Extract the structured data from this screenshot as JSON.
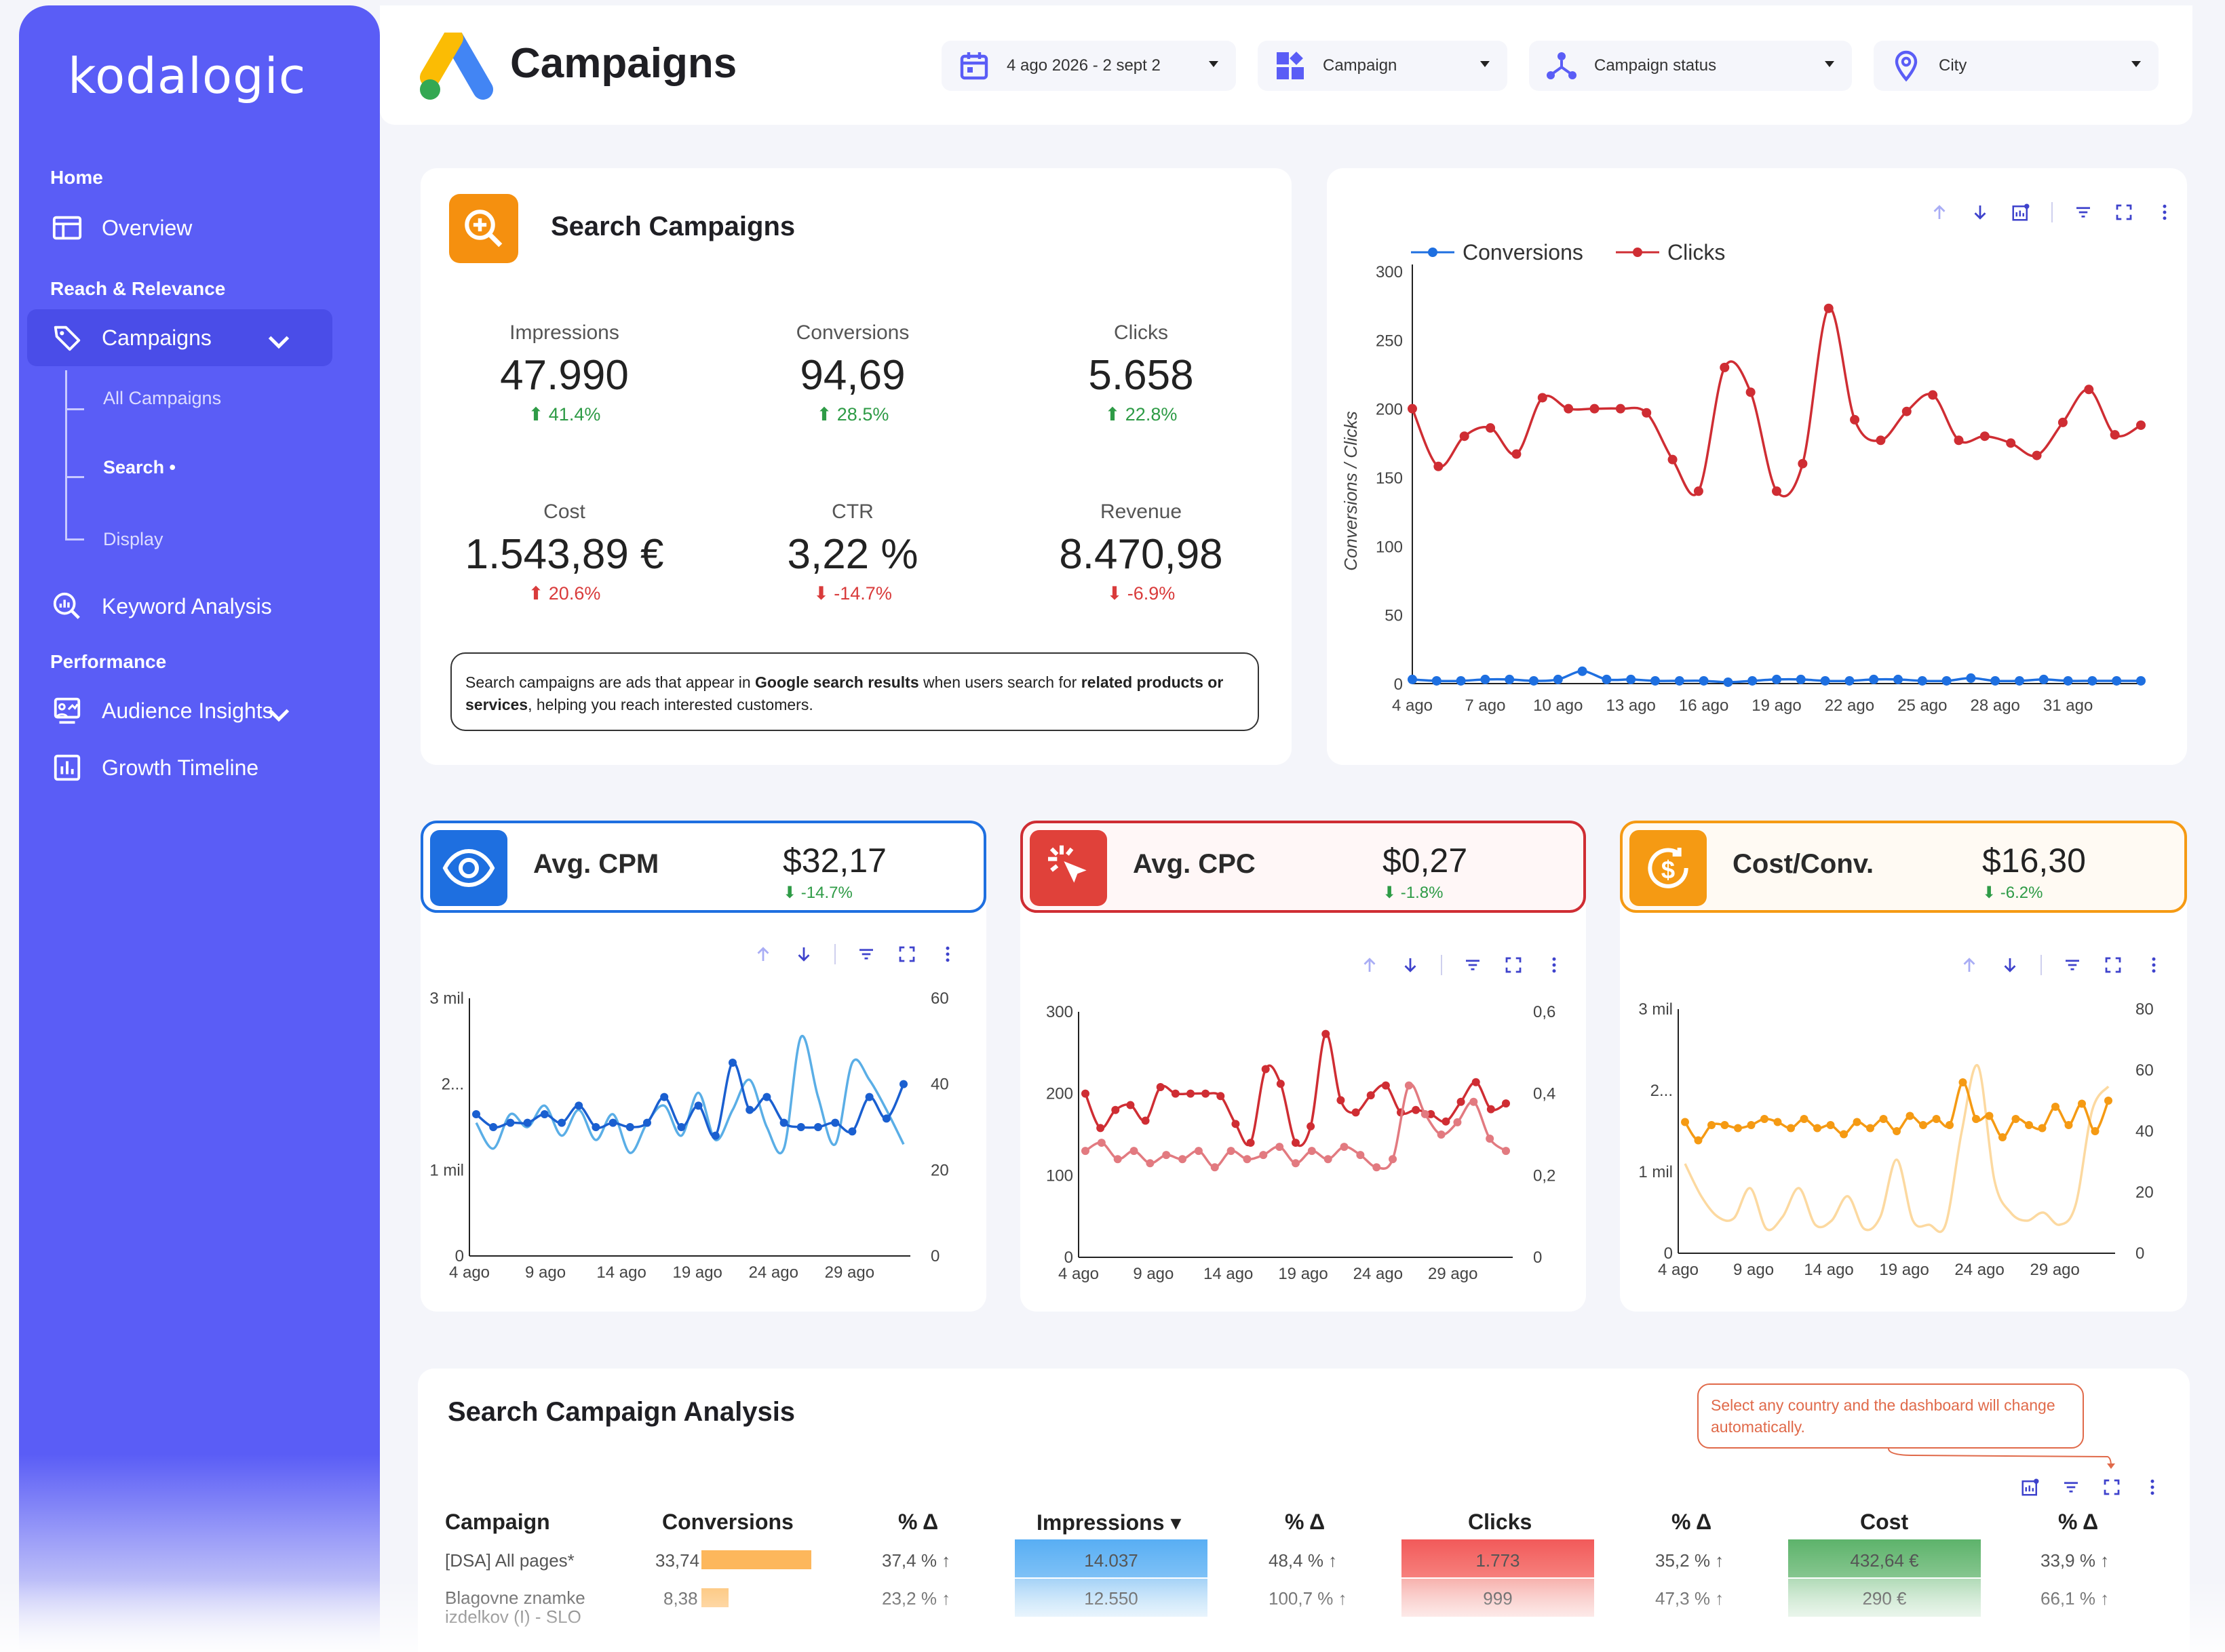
{
  "brand": {
    "logo_text": "kodalogic"
  },
  "colors": {
    "sidebar": "#5a5df6",
    "accent_red": "#cf2d33",
    "accent_blue": "#1e6fe0",
    "accent_orange": "#f59a13",
    "positive": "#2e9b46",
    "negative": "#d93b3b"
  },
  "sidebar": {
    "sections": [
      {
        "title": "Home",
        "items": [
          {
            "label": "Overview",
            "icon": "dashboard-icon"
          }
        ]
      },
      {
        "title": "Reach & Relevance",
        "items": [
          {
            "label": "Campaigns",
            "icon": "tag-icon",
            "expanded": true,
            "sub": [
              "All Campaigns",
              "Search •",
              "Display"
            ]
          },
          {
            "label": "Keyword Analysis",
            "icon": "magnify-chart-icon"
          }
        ]
      },
      {
        "title": "Performance",
        "items": [
          {
            "label": "Audience Insights",
            "icon": "audience-icon"
          },
          {
            "label": "Growth Timeline",
            "icon": "bar-chart-icon"
          }
        ]
      }
    ]
  },
  "header": {
    "title": "Campaigns",
    "filters": {
      "date": "4 ago 2026 - 2 sept 2",
      "campaign": "Campaign",
      "status": "Campaign status",
      "city": "City"
    }
  },
  "search_card": {
    "title": "Search Campaigns",
    "kpis": [
      {
        "label": "Impressions",
        "value": "47.990",
        "delta": "41.4%",
        "dir": "up"
      },
      {
        "label": "Conversions",
        "value": "94,69",
        "delta": "28.5%",
        "dir": "up"
      },
      {
        "label": "Clicks",
        "value": "5.658",
        "delta": "22.8%",
        "dir": "up"
      },
      {
        "label": "Cost",
        "value": "1.543,89 €",
        "delta": "20.6%",
        "dir": "up_bad"
      },
      {
        "label": "CTR",
        "value": "3,22 %",
        "delta": "-14.7%",
        "dir": "down"
      },
      {
        "label": "Revenue",
        "value": "8.470,98",
        "delta": "-6.9%",
        "dir": "down"
      }
    ],
    "note_parts": [
      "Search campaigns are ads that appear in ",
      "Google search results",
      " when users search for ",
      "related products or services",
      ", helping you reach interested customers."
    ]
  },
  "metrics": [
    {
      "name": "Avg. CPM",
      "value": "$32,17",
      "delta": "-14.7%",
      "icon": "eye-icon",
      "color": "#1e6fe0"
    },
    {
      "name": "Avg. CPC",
      "value": "$0,27",
      "delta": "-1.8%",
      "icon": "click-icon",
      "color": "#cf2d33"
    },
    {
      "name": "Cost/Conv.",
      "value": "$16,30",
      "delta": "-6.2%",
      "icon": "dollar-icon",
      "color": "#f59a13"
    }
  ],
  "chart_data": [
    {
      "type": "line",
      "title": "",
      "xlabel": "",
      "ylabel": "Conversions / Clicks",
      "ylim": [
        0,
        300
      ],
      "yticks": [
        "0",
        "50",
        "100",
        "150",
        "200",
        "250",
        "300"
      ],
      "x_tick_labels": [
        "4 ago",
        "7 ago",
        "10 ago",
        "13 ago",
        "16 ago",
        "19 ago",
        "22 ago",
        "25 ago",
        "28 ago",
        "31 ago"
      ],
      "legend": "top-left",
      "series": [
        {
          "name": "Conversions",
          "color": "#1e6fe0",
          "values": [
            3,
            2,
            2,
            3,
            3,
            2,
            3,
            9,
            3,
            3,
            2,
            2,
            2,
            1,
            2,
            3,
            3,
            2,
            2,
            3,
            3,
            2,
            2,
            4,
            2,
            2,
            3,
            2,
            2,
            2,
            2
          ]
        },
        {
          "name": "Clicks",
          "color": "#cf2d33",
          "values": [
            200,
            158,
            180,
            186,
            167,
            208,
            200,
            200,
            200,
            197,
            163,
            140,
            230,
            212,
            140,
            160,
            273,
            192,
            177,
            198,
            210,
            177,
            180,
            175,
            166,
            190,
            214,
            181,
            188
          ]
        }
      ]
    },
    {
      "type": "line",
      "title": "",
      "ylim_left": [
        0,
        3000
      ],
      "ylim_right": [
        0,
        60
      ],
      "yticks_left": [
        "0",
        "1 mil",
        "2...",
        "3 mil"
      ],
      "yticks_right": [
        "0",
        "20",
        "40",
        "60"
      ],
      "x_tick_labels": [
        "4 ago",
        "9 ago",
        "14 ago",
        "19 ago",
        "24 ago",
        "29 ago"
      ],
      "series": [
        {
          "color": "#5aaee6",
          "axis": "left",
          "values": [
            1550,
            1250,
            1650,
            1500,
            1750,
            1400,
            1700,
            1350,
            1650,
            1200,
            1550,
            1750,
            1400,
            1900,
            1350,
            1700,
            2050,
            1500,
            1250,
            2550,
            1850,
            1300,
            2250,
            2050,
            1700,
            1300
          ]
        },
        {
          "color": "#1a5fd0",
          "axis": "right",
          "values": [
            33,
            30,
            31,
            31,
            33,
            31,
            35,
            30,
            31,
            30,
            31,
            37,
            30,
            35,
            28,
            45,
            34,
            37,
            31,
            30,
            30,
            31,
            29,
            37,
            32,
            40
          ]
        }
      ]
    },
    {
      "type": "line",
      "title": "",
      "ylim_left": [
        0,
        300
      ],
      "ylim_right": [
        0,
        0.6
      ],
      "yticks_left": [
        "0",
        "100",
        "200",
        "300"
      ],
      "yticks_right": [
        "0",
        "0,2",
        "0,4",
        "0,6"
      ],
      "x_tick_labels": [
        "4 ago",
        "9 ago",
        "14 ago",
        "19 ago",
        "24 ago",
        "29 ago"
      ],
      "series": [
        {
          "color": "#cf2d33",
          "axis": "left",
          "values": [
            200,
            158,
            180,
            186,
            167,
            208,
            200,
            200,
            200,
            197,
            163,
            140,
            230,
            212,
            140,
            160,
            273,
            192,
            177,
            198,
            210,
            177,
            180,
            175,
            166,
            190,
            214,
            181,
            188
          ]
        },
        {
          "color": "#e27a80",
          "axis": "right",
          "values": [
            0.26,
            0.28,
            0.24,
            0.26,
            0.23,
            0.25,
            0.24,
            0.26,
            0.22,
            0.26,
            0.24,
            0.25,
            0.27,
            0.23,
            0.26,
            0.24,
            0.27,
            0.25,
            0.22,
            0.24,
            0.42,
            0.35,
            0.3,
            0.33,
            0.38,
            0.29,
            0.26
          ]
        }
      ]
    },
    {
      "type": "line",
      "title": "",
      "ylim_left": [
        0,
        3000
      ],
      "ylim_right": [
        0,
        80
      ],
      "yticks_left": [
        "0",
        "1 mil",
        "2...",
        "3 mil"
      ],
      "yticks_right": [
        "0",
        "20",
        "40",
        "60",
        "80"
      ],
      "x_tick_labels": [
        "4 ago",
        "9 ago",
        "14 ago",
        "19 ago",
        "24 ago",
        "29 ago"
      ],
      "series": [
        {
          "color": "#fcd9a0",
          "axis": "left",
          "values": [
            1100,
            700,
            450,
            430,
            800,
            300,
            450,
            800,
            350,
            400,
            700,
            300,
            450,
            1150,
            400,
            350,
            350,
            1500,
            2300,
            900,
            500,
            400,
            500,
            350,
            600,
            1750,
            2050
          ]
        },
        {
          "color": "#f59a13",
          "axis": "right",
          "values": [
            43,
            37,
            42,
            42,
            41,
            42,
            44,
            43,
            41,
            44,
            41,
            42,
            39,
            43,
            41,
            44,
            40,
            45,
            42,
            44,
            42,
            56,
            44,
            45,
            38,
            44,
            42,
            41,
            48,
            42,
            49,
            40,
            50
          ]
        }
      ]
    }
  ],
  "analysis": {
    "title": "Search Campaign Analysis",
    "tooltip": "Select any country and the dashboard will change automatically.",
    "columns": [
      "Campaign",
      "Conversions",
      "% Δ",
      "Impressions ▾",
      "% Δ",
      "Clicks",
      "% Δ",
      "Cost",
      "% Δ"
    ],
    "rows": [
      {
        "campaign": "[DSA] All pages*",
        "conversions": "33,74",
        "conv_frac": 1.0,
        "conv_d": "37,4 % ↑",
        "impressions": "14.037",
        "imp_d": "48,4 % ↑",
        "clicks": "1.773",
        "clk_d": "35,2 % ↑",
        "cost": "432,64 €",
        "cost_d": "33,9 % ↑"
      },
      {
        "campaign": "Blagovne znamke izdelkov (I) - SLO",
        "conversions": "8,38",
        "conv_frac": 0.25,
        "conv_d": "23,2 % ↑",
        "impressions": "12.550",
        "imp_d": "100,7 % ↑",
        "clicks": "999",
        "clk_d": "47,3 % ↑",
        "cost": "290 €",
        "cost_d": "66,1 % ↑"
      }
    ]
  }
}
